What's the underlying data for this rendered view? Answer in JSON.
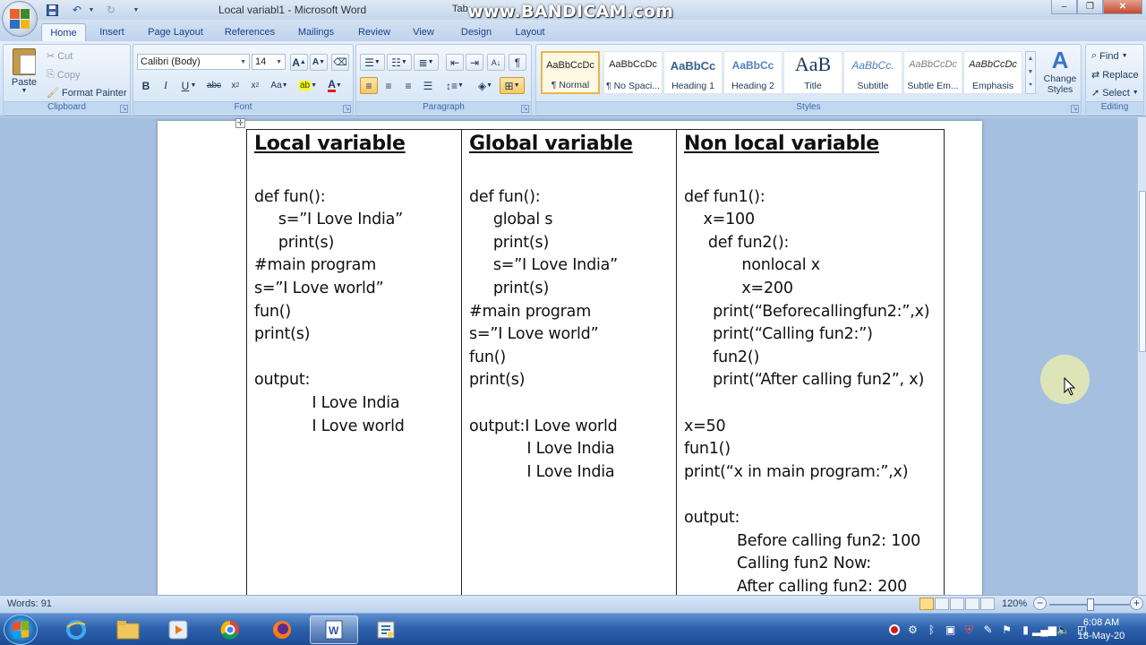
{
  "window": {
    "title": "Local variabl1 - Microsoft Word",
    "contextual_tab": "Tab",
    "watermark": "www.BANDICAM.com",
    "controls": {
      "minimize": "–",
      "maximize": "❐",
      "close": "✕"
    }
  },
  "tabs": [
    {
      "label": "Home",
      "active": true
    },
    {
      "label": "Insert"
    },
    {
      "label": "Page Layout"
    },
    {
      "label": "References"
    },
    {
      "label": "Mailings"
    },
    {
      "label": "Review"
    },
    {
      "label": "View"
    },
    {
      "label": "Design"
    },
    {
      "label": "Layout"
    }
  ],
  "ribbon": {
    "clipboard": {
      "label": "Clipboard",
      "paste": "Paste",
      "cut": "Cut",
      "copy": "Copy",
      "format_painter": "Format Painter"
    },
    "font": {
      "label": "Font",
      "font_name": "Calibri (Body)",
      "font_size": "14"
    },
    "paragraph": {
      "label": "Paragraph"
    },
    "styles": {
      "label": "Styles",
      "items": [
        {
          "sample": "AaBbCcDc",
          "name": "¶ Normal",
          "selected": true
        },
        {
          "sample": "AaBbCcDc",
          "name": "¶ No Spaci..."
        },
        {
          "sample": "AaBbCc",
          "name": "Heading 1"
        },
        {
          "sample": "AaBbCc",
          "name": "Heading 2"
        },
        {
          "sample": "AaB",
          "name": "Title"
        },
        {
          "sample": "AaBbCc.",
          "name": "Subtitle"
        },
        {
          "sample": "AaBbCcDc",
          "name": "Subtle Em..."
        },
        {
          "sample": "AaBbCcDc",
          "name": "Emphasis"
        }
      ],
      "change_styles": "Change Styles"
    },
    "editing": {
      "label": "Editing",
      "find": "Find",
      "replace": "Replace",
      "select": "Select"
    }
  },
  "document": {
    "columns": [
      {
        "heading": "Local variable",
        "lines": [
          "",
          "def fun():",
          "     s=”I Love India”",
          "     print(s)",
          "#main program",
          "s=”I Love world”",
          "fun()",
          "print(s)",
          "",
          "output:",
          "            I Love India",
          "            I Love world"
        ]
      },
      {
        "heading": "Global variable",
        "lines": [
          "",
          "def fun():",
          "     global s",
          "     print(s)",
          "     s=”I Love India”",
          "     print(s)",
          "#main program",
          "s=”I Love world”",
          "fun()",
          "print(s)",
          "",
          "output:I Love world",
          "            I Love India",
          "            I Love India"
        ]
      },
      {
        "heading": "Non local variable",
        "lines": [
          "",
          "def fun1():",
          "    x=100",
          "     def fun2():",
          "            nonlocal x",
          "            x=200",
          "      print(“Beforecallingfun2:”,x)",
          "      print(“Calling fun2:”)",
          "      fun2()",
          "      print(“After calling fun2”, x)",
          "",
          "x=50",
          "fun1()",
          "print(“x in main program:”,x)",
          "",
          "output:",
          "           Before calling fun2: 100",
          "           Calling fun2 Now:",
          "           After calling fun2: 200"
        ]
      }
    ]
  },
  "statusbar": {
    "words": "Words: 91",
    "zoom": "120%"
  },
  "taskbar": {
    "time": "6:08 AM",
    "date": "18-May-20"
  }
}
